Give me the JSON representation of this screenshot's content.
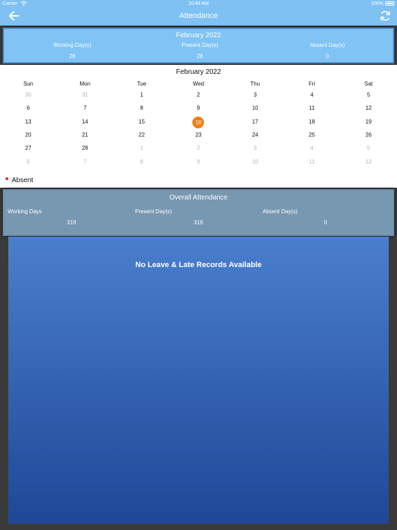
{
  "status_bar": {
    "carrier": "Carrier",
    "time": "10:43 AM",
    "battery": "100%"
  },
  "nav": {
    "title": "Attendance"
  },
  "month_summary": {
    "title": "February 2022",
    "working_label": "Working Day(s)",
    "working_value": "28",
    "present_label": "Present Day(s)",
    "present_value": "28",
    "absent_label": "Absent Day(s)",
    "absent_value": "0"
  },
  "calendar": {
    "title": "February 2022",
    "weekdays": [
      "Sun",
      "Mon",
      "Tue",
      "Wed",
      "Thu",
      "Fri",
      "Sat"
    ],
    "weeks": [
      [
        "30",
        "31",
        "1",
        "2",
        "3",
        "4",
        "5"
      ],
      [
        "6",
        "7",
        "8",
        "9",
        "10",
        "11",
        "12"
      ],
      [
        "13",
        "14",
        "15",
        "16",
        "17",
        "18",
        "19"
      ],
      [
        "20",
        "21",
        "22",
        "23",
        "24",
        "25",
        "26"
      ],
      [
        "27",
        "28",
        "1",
        "2",
        "3",
        "4",
        "5"
      ],
      [
        "6",
        "7",
        "8",
        "9",
        "10",
        "11",
        "12"
      ]
    ],
    "muted": [
      [
        0,
        0
      ],
      [
        0,
        1
      ],
      [
        4,
        2
      ],
      [
        4,
        3
      ],
      [
        4,
        4
      ],
      [
        4,
        5
      ],
      [
        4,
        6
      ],
      [
        5,
        0
      ],
      [
        5,
        1
      ],
      [
        5,
        2
      ],
      [
        5,
        3
      ],
      [
        5,
        4
      ],
      [
        5,
        5
      ],
      [
        5,
        6
      ]
    ],
    "today": [
      2,
      3
    ],
    "legend_label": "Absent",
    "colors": {
      "today": "#f27d14",
      "absent_dot": "#e02020"
    }
  },
  "overall": {
    "title": "Overall Attendance",
    "working_label": "Working Days",
    "working_value": "319",
    "present_label": "Present Day(s)",
    "present_value": "319",
    "absent_label": "Absent Day(s)",
    "absent_value": "0"
  },
  "main": {
    "empty_message": "No Leave & Late Records Available"
  },
  "colors": {
    "nav": "#80c1f4",
    "month_card": "#80c3f5",
    "overall_card": "#7897b1"
  }
}
